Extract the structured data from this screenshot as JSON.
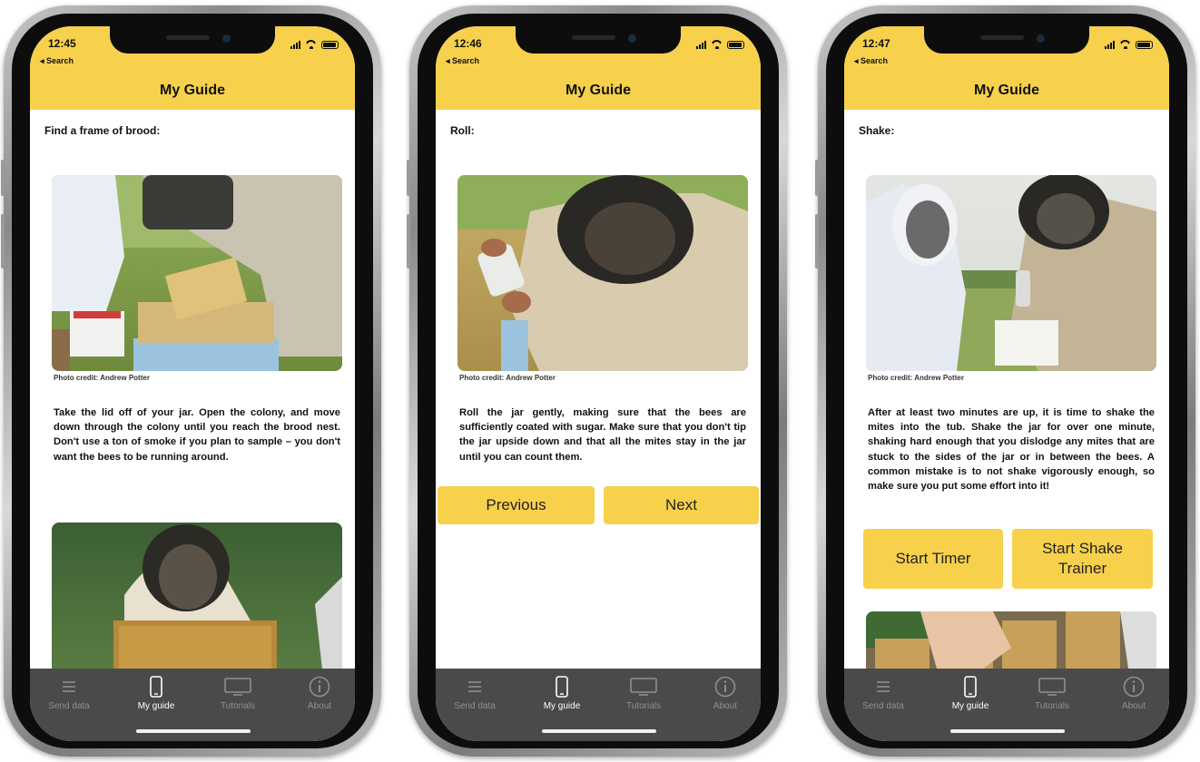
{
  "colors": {
    "accent": "#f7d14c",
    "tabbar": "#4a4a4a",
    "tab_inactive": "#8f8f8f",
    "tab_active": "#ffffff"
  },
  "common": {
    "back_label": "◂ Search",
    "nav_title": "My Guide",
    "photo_credit": "Photo credit: Andrew Potter",
    "tabs": [
      {
        "label": "Send data",
        "icon": "list-icon"
      },
      {
        "label": "My guide",
        "icon": "phone-icon"
      },
      {
        "label": "Tutorials",
        "icon": "monitor-icon"
      },
      {
        "label": "About",
        "icon": "info-icon"
      }
    ]
  },
  "screens": [
    {
      "time": "12:45",
      "step": "Find a frame of brood:",
      "description": "Take the lid off of your jar. Open the colony, and move down through the colony until you reach the brood nest. Don't use a ton of smoke if you plan to sample – you don't want the bees to be running around."
    },
    {
      "time": "12:46",
      "step": "Roll:",
      "description": "Roll the jar gently, making sure that the bees are sufficiently coated with sugar. Make sure that you don't tip the jar upside down and that all the mites stay in the jar until you can count them.",
      "buttons": [
        "Previous",
        "Next"
      ]
    },
    {
      "time": "12:47",
      "step": "Shake:",
      "description": "After at least two minutes are up, it is time to shake the mites into the tub. Shake the jar for over one minute, shaking hard enough that you dislodge any mites that are stuck to the sides of the jar or in between the bees. A common mistake is to not shake vigorously enough, so make sure you put some effort into it!",
      "buttons": [
        "Start Timer",
        "Start Shake Trainer"
      ]
    }
  ]
}
